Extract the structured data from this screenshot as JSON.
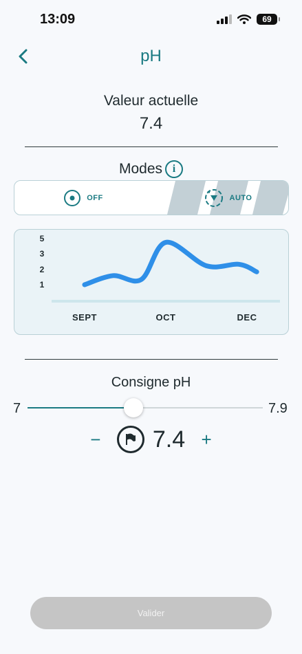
{
  "status_bar": {
    "time": "13:09",
    "battery": "69"
  },
  "header": {
    "title": "pH"
  },
  "current": {
    "label": "Valeur actuelle",
    "value": "7.4"
  },
  "modes": {
    "label": "Modes",
    "off_label": "OFF",
    "auto_label": "AUTO",
    "selected": "AUTO"
  },
  "chart_data": {
    "type": "line",
    "categories": [
      "SEPT",
      "OCT",
      "DEC"
    ],
    "y_ticks": [
      "5",
      "3",
      "2",
      "1"
    ],
    "series": [
      {
        "values": [
          {
            "x": 0.0,
            "y": 1.0
          },
          {
            "x": 0.35,
            "y": 1.6
          },
          {
            "x": 0.7,
            "y": 1.35
          },
          {
            "x": 1.0,
            "y": 3.8
          },
          {
            "x": 1.5,
            "y": 2.25
          },
          {
            "x": 1.9,
            "y": 2.35
          },
          {
            "x": 2.12,
            "y": 1.85
          }
        ]
      }
    ],
    "colors": {
      "line": "#2f8fe8",
      "baseline": "#cde6ec"
    },
    "grid": false
  },
  "setpoint": {
    "label": "Consigne pH",
    "min": "7",
    "max": "7.9",
    "value": "7.4",
    "slider_fraction": 0.45,
    "minus": "−",
    "plus": "+"
  },
  "footer": {
    "validate_label": "Valider"
  }
}
